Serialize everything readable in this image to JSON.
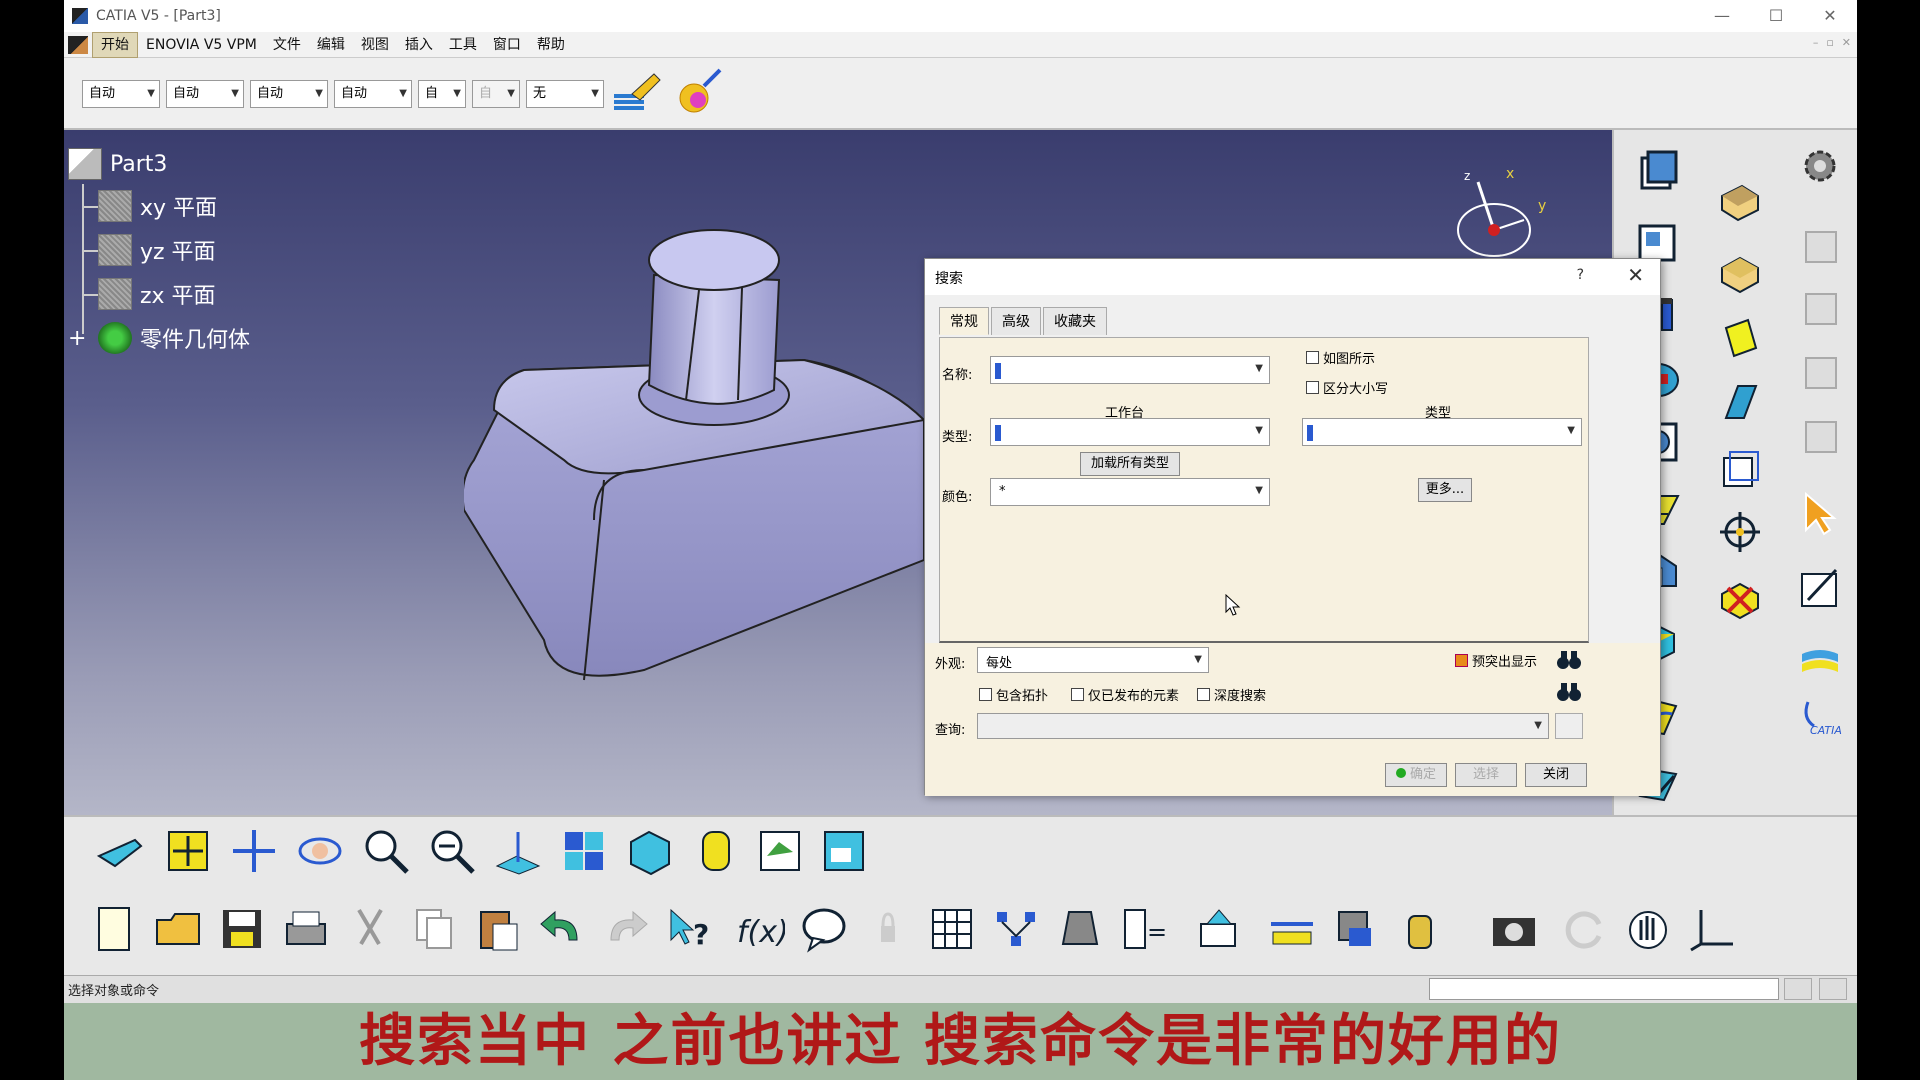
{
  "window": {
    "title": "CATIA V5 - [Part3]",
    "minimize": "—",
    "maximize": "☐",
    "close": "✕"
  },
  "menu": {
    "items": [
      "开始",
      "ENOVIA V5 VPM",
      "文件",
      "编辑",
      "视图",
      "插入",
      "工具",
      "窗口",
      "帮助"
    ],
    "mdi": [
      "–",
      "▫",
      "✕"
    ]
  },
  "props": {
    "selects": [
      "自动",
      "自动",
      "自动",
      "自动",
      "自",
      "自",
      "无"
    ]
  },
  "tree": {
    "root": "Part3",
    "nodes": [
      "xy 平面",
      "yz 平面",
      "zx 平面",
      "零件几何体"
    ]
  },
  "compass": {
    "x": "x",
    "y": "y",
    "z": "z"
  },
  "dialog": {
    "title": "搜索",
    "help": "?",
    "close": "✕",
    "tabs": [
      "常规",
      "高级",
      "收藏夹"
    ],
    "name_label": "名称:",
    "workbench_label": "工作台",
    "type_label": "类型:",
    "type_header": "类型",
    "load_all_button": "加载所有类型",
    "color_label": "颜色:",
    "color_value": "*",
    "more_button": "更多...",
    "as_shown_label": "如图所示",
    "case_sensitive_label": "区分大小写",
    "appearance_label": "外观:",
    "appearance_value": "每处",
    "highlight_label": "预突出显示",
    "include_topology_label": "包含拓扑",
    "published_only_label": "仅已发布的元素",
    "deep_search_label": "深度搜索",
    "query_label": "查询:",
    "ok_button": "确定",
    "select_button": "选择",
    "close_button": "关闭"
  },
  "status": {
    "text": "选择对象或命令"
  },
  "subtitle": "搜索当中 之前也讲过 搜索命令是非常的好用的",
  "brand": {
    "logo": "CATIA"
  },
  "colors": {
    "accent": "#2a5ad0",
    "subtitle": "#b01818",
    "viewport_top": "#3a3d6e"
  }
}
